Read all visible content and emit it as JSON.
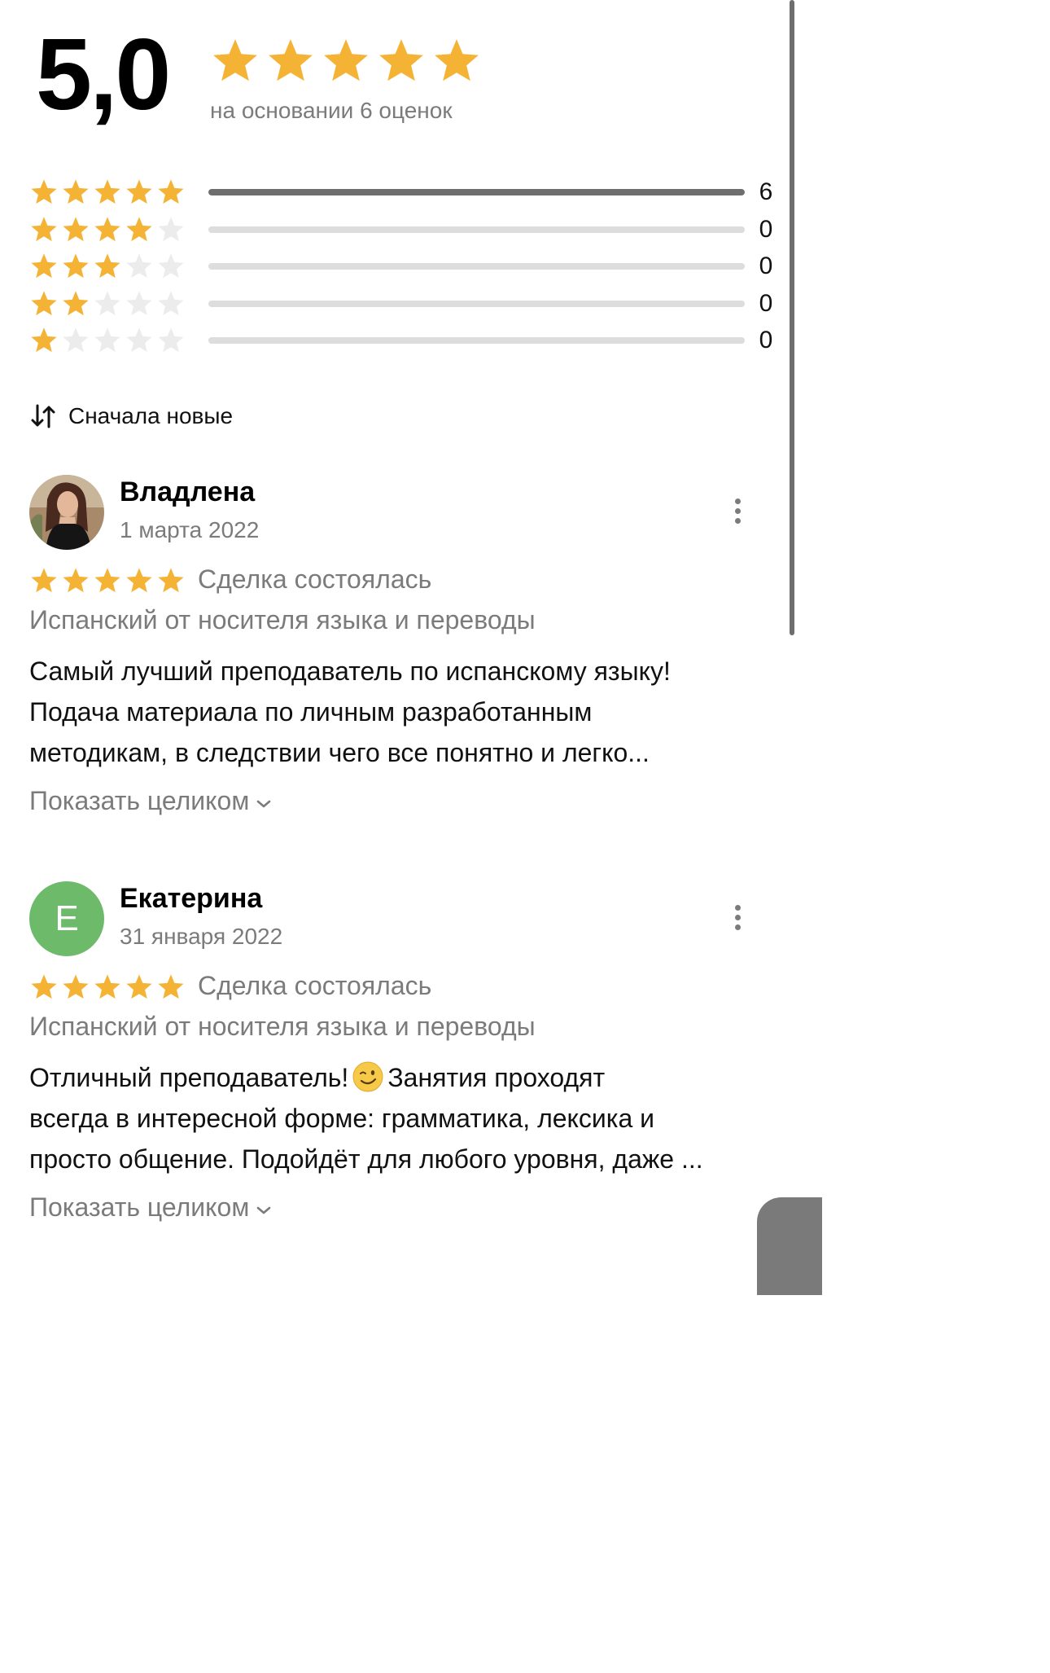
{
  "rating": {
    "score": "5,0",
    "stars_filled": 5,
    "based_on": "на основании 6 оценок"
  },
  "distribution": [
    {
      "stars": 5,
      "count": "6",
      "fraction": 1.0
    },
    {
      "stars": 4,
      "count": "0",
      "fraction": 0
    },
    {
      "stars": 3,
      "count": "0",
      "fraction": 0
    },
    {
      "stars": 2,
      "count": "0",
      "fraction": 0
    },
    {
      "stars": 1,
      "count": "0",
      "fraction": 0
    }
  ],
  "sort": {
    "label": "Сначала новые"
  },
  "reviews": [
    {
      "name": "Владлена",
      "date": "1 марта 2022",
      "rating": 5,
      "deal": "Сделка состоялась",
      "service": "Испанский от носителя языка и переводы",
      "text_lines": [
        "Самый лучший преподаватель по испанскому языку!",
        "Подача материала по личным разработанным",
        "методикам, в следствии чего все понятно и легко..."
      ],
      "show_more": "Показать целиком"
    },
    {
      "name": "Екатерина",
      "avatar_letter": "E",
      "avatar_color": "#6cba6a",
      "date": "31 января 2022",
      "rating": 5,
      "deal": "Сделка состоялась",
      "service": "Испанский от носителя языка и переводы",
      "text_line1_before": "Отличный преподаватель!",
      "text_line1_emoji": "winking-face",
      "text_line1_after": "Занятия проходят",
      "text_lines_rest": [
        "всегда в интересной форме: грамматика, лексика и",
        "просто общение. Подойдёт для любого уровня, даже ..."
      ],
      "show_more": "Показать целиком"
    }
  ],
  "colors": {
    "star_filled": "#f5b335",
    "star_empty": "#ececec",
    "muted_text": "#7b7b7b",
    "bar_fill": "#6e6e6e",
    "bar_track": "#dddddd"
  }
}
